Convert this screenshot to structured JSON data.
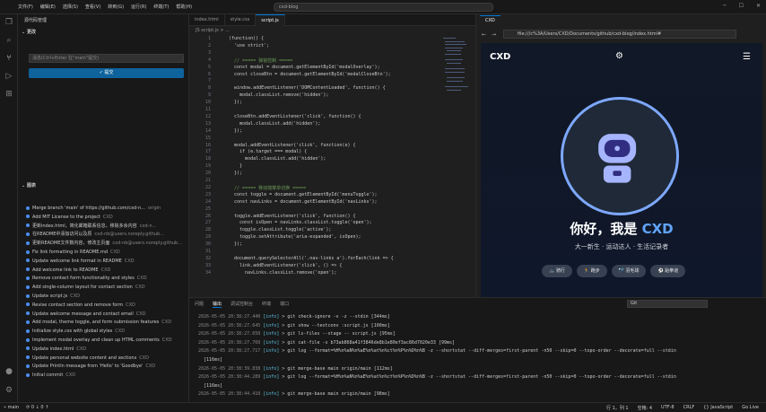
{
  "menu": [
    "文件(F)",
    "编辑(E)",
    "选择(S)",
    "查看(V)",
    "转到(G)",
    "运行(R)",
    "终端(T)",
    "帮助(H)"
  ],
  "command_center": "cxd-blog",
  "sidebar": {
    "title": "源代码管理",
    "changes_label": "更改",
    "message_placeholder": "消息(Ctrl+Enter 在\"main\"提交)",
    "commit_label": "✓ 提交",
    "graph_label": "图表",
    "graph": [
      {
        "msg": "Merge branch 'main' of https://github.com/cxd-n...",
        "tag": "origin"
      },
      {
        "msg": "Add MIT License to the project",
        "sub": "CXD"
      },
      {
        "msg": "更新index.html，简化邮箱联系信息，移除多余内容",
        "sub": "cxd-n..."
      },
      {
        "msg": "在README中添加访问以及原",
        "sub": "cxd-nb@users.noreply.github..."
      },
      {
        "msg": "更新README文件数内容，修改主页面",
        "sub": "cxd-nb@users.noreply.github..."
      },
      {
        "msg": "Fix link formatting in README.md",
        "sub": "CXD"
      },
      {
        "msg": "Update welcome link format in README",
        "sub": "CXD"
      },
      {
        "msg": "Add welcome link to README",
        "sub": "CXD"
      },
      {
        "msg": "Remove contact form functionality and styles",
        "sub": "CXD"
      },
      {
        "msg": "Add single-column layout for contact section",
        "sub": "CXD"
      },
      {
        "msg": "Update script.js",
        "sub": "CXD"
      },
      {
        "msg": "Revise contact section and remove form",
        "sub": "CXD"
      },
      {
        "msg": "Update welcome message and contact email",
        "sub": "CXD"
      },
      {
        "msg": "Add modal, theme toggle, and form submission features",
        "sub": "CXD"
      },
      {
        "msg": "Initialize style.css with global styles",
        "sub": "CXD"
      },
      {
        "msg": "Implement modal overlay and clean up HTML comments",
        "sub": "CXD"
      },
      {
        "msg": "Update index.html",
        "sub": "CXD"
      },
      {
        "msg": "Update personal website content and sections",
        "sub": "CXD"
      },
      {
        "msg": "Update Println message from 'Hello' to 'Goodbye'",
        "sub": "CXD"
      },
      {
        "msg": "Initial commit",
        "sub": "CXD"
      }
    ]
  },
  "editor": {
    "tabs": [
      "index.html",
      "style.css",
      "script.js"
    ],
    "breadcrumb": "JS script.js > ...",
    "lines": [
      {
        "n": "1",
        "t": "(function() {"
      },
      {
        "n": "2",
        "t": "  'use strict';"
      },
      {
        "n": "3",
        "t": ""
      },
      {
        "n": "4",
        "t": "  // ===== 弹窗控制 ====="
      },
      {
        "n": "5",
        "t": "  const modal = document.getElementById('modalOverlay');"
      },
      {
        "n": "6",
        "t": "  const closeBtn = document.getElementById('modalCloseBtn');"
      },
      {
        "n": "7",
        "t": ""
      },
      {
        "n": "8",
        "t": "  window.addEventListener('DOMContentLoaded', function() {"
      },
      {
        "n": "9",
        "t": "    modal.classList.remove('hidden');"
      },
      {
        "n": "10",
        "t": "  });"
      },
      {
        "n": "11",
        "t": ""
      },
      {
        "n": "12",
        "t": "  closeBtn.addEventListener('click', function() {"
      },
      {
        "n": "13",
        "t": "    modal.classList.add('hidden');"
      },
      {
        "n": "14",
        "t": "  });"
      },
      {
        "n": "15",
        "t": ""
      },
      {
        "n": "16",
        "t": "  modal.addEventListener('click', function(e) {"
      },
      {
        "n": "17",
        "t": "    if (e.target === modal) {"
      },
      {
        "n": "18",
        "t": "      modal.classList.add('hidden');"
      },
      {
        "n": "19",
        "t": "    }"
      },
      {
        "n": "20",
        "t": "  });"
      },
      {
        "n": "21",
        "t": ""
      },
      {
        "n": "22",
        "t": "  // ===== 移动端菜单切换 ====="
      },
      {
        "n": "23",
        "t": "  const toggle = document.getElementById('menuToggle');"
      },
      {
        "n": "24",
        "t": "  const navLinks = document.getElementById('navLinks');"
      },
      {
        "n": "25",
        "t": ""
      },
      {
        "n": "26",
        "t": "  toggle.addEventListener('click', function() {"
      },
      {
        "n": "27",
        "t": "    const isOpen = navLinks.classList.toggle('open');"
      },
      {
        "n": "28",
        "t": "    toggle.classList.toggle('active');"
      },
      {
        "n": "29",
        "t": "    toggle.setAttribute('aria-expanded', isOpen);"
      },
      {
        "n": "30",
        "t": "  });"
      },
      {
        "n": "31",
        "t": ""
      },
      {
        "n": "32",
        "t": "  document.querySelectorAll('.nav-links a').forEach(link => {"
      },
      {
        "n": "33",
        "t": "    link.addEventListener('click', () => {"
      },
      {
        "n": "34",
        "t": "      navLinks.classList.remove('open');"
      }
    ]
  },
  "preview": {
    "tab": "CXD",
    "url": "file:///c%3A/Users/CXD/Documents/github/cxd-blog/index.html#",
    "brand": "CXD",
    "hero_prefix": "你好，我是 ",
    "hero_name": "CXD",
    "subtitle": "大一新生 · 运动达人 · 生活记录者",
    "chips": [
      "🚲 骑行",
      "🏃 跑步",
      "🏸 羽毛球",
      "⚽ 跆拳道"
    ]
  },
  "terminal": {
    "tabs": [
      "问题",
      "输出",
      "调试控制台",
      "终端",
      "端口"
    ],
    "filter": "Git",
    "lines": [
      {
        "ts": "2026-05-05 20:38:27.440",
        "lvl": "[info]",
        "txt": "> git check-ignore -v -z --stdin [344ms]"
      },
      {
        "ts": "2026-05-05 20:38:27.645",
        "lvl": "[info]",
        "txt": "> git show --textconv :script.js [100ms]"
      },
      {
        "ts": "2026-05-05 20:38:27.650",
        "lvl": "[info]",
        "txt": "> git ls-files --stage -- script.js [95ms]"
      },
      {
        "ts": "2026-05-05 20:38:27.760",
        "lvl": "[info]",
        "txt": "> git cat-file -s b73ab868a41f3846de8b1e80ef3ac86d7020e33 [99ms]"
      },
      {
        "ts": "2026-05-05 20:38:27.717",
        "lvl": "[info]",
        "txt": "> git log --format=%H%n%aN%n%aE%n%at%n%ct%n%P%n%D%n%B -z --shortstat --diff-merges=first-parent -n50 --skip=0 --topo-order --decorate=full --stdin"
      },
      {
        "ts": "",
        "lvl": "",
        "txt": "[116ms]"
      },
      {
        "ts": "2026-05-05 20:38:39.838",
        "lvl": "[info]",
        "txt": "> git merge-base main origin/main [112ms]"
      },
      {
        "ts": "2026-05-05 20:38:44.289",
        "lvl": "[info]",
        "txt": "> git log --format=%H%n%aN%n%aE%n%at%n%ct%n%P%n%D%n%B -z --shortstat --diff-merges=first-parent -n50 --skip=0 --topo-order --decorate=full --stdin"
      },
      {
        "ts": "",
        "lvl": "",
        "txt": "[116ms]"
      },
      {
        "ts": "2026-05-05 20:38:44.410",
        "lvl": "[info]",
        "txt": "> git merge-base main origin/main [98ms]"
      }
    ]
  },
  "status": {
    "branch": "main",
    "sync": "⟳ 0 ↓ 0 ↑",
    "position": "行 1，列 1",
    "spaces": "空格: 4",
    "encoding": "UTF-8",
    "eol": "CRLF",
    "lang": "{} JavaScript",
    "golive": "Go Live"
  }
}
